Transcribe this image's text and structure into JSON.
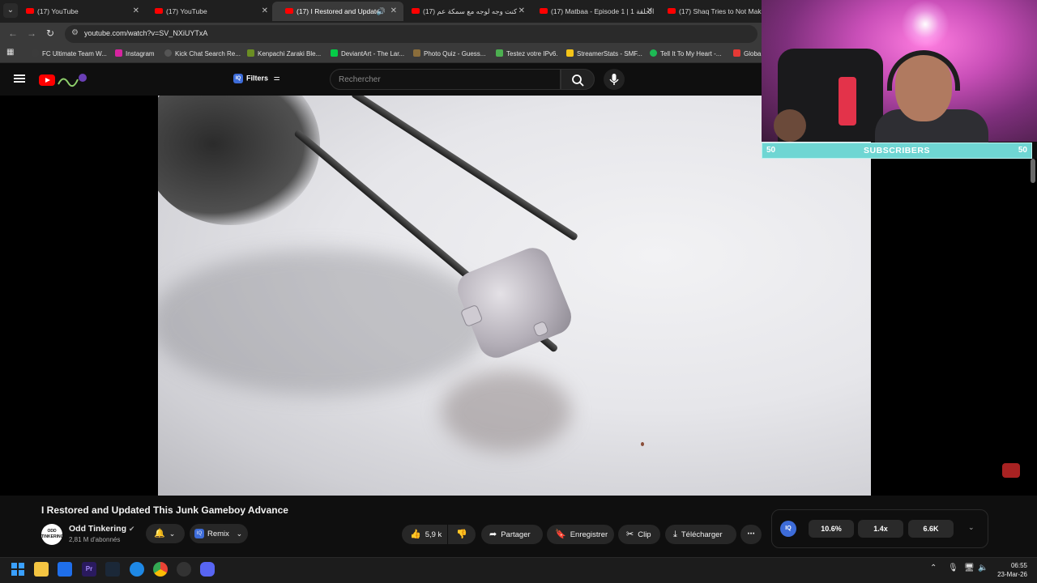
{
  "tabs": [
    {
      "label": "(17) YouTube",
      "active": false
    },
    {
      "label": "(17) YouTube",
      "active": false
    },
    {
      "label": "(17) I Restored and Update",
      "active": true
    },
    {
      "label": "(17) كنت وجه لوجه مع سمكة عم",
      "active": false
    },
    {
      "label": "(17) Matbaa - Episode 1 | 1 الحلقة",
      "active": false
    },
    {
      "label": "(17) Shaq Tries to Not Make",
      "active": false
    }
  ],
  "address": {
    "url": "youtube.com/watch?v=SV_NXiUYTxA"
  },
  "bookmarks": [
    {
      "label": "FC Ultimate Team W...",
      "color": "#3b3b3b"
    },
    {
      "label": "Instagram",
      "color": "#d6249f"
    },
    {
      "label": "Kick Chat Search Re...",
      "color": "#555555"
    },
    {
      "label": "Kenpachi Zaraki Ble...",
      "color": "#6b8e23"
    },
    {
      "label": "DeviantArt - The Lar...",
      "color": "#05cc47"
    },
    {
      "label": "Photo Quiz - Guess...",
      "color": "#8a6d3b"
    },
    {
      "label": "Testez votre IPv6.",
      "color": "#4caf50"
    },
    {
      "label": "StreamerStats - SMF...",
      "color": "#f5c518"
    },
    {
      "label": "Tell It To My Heart -...",
      "color": "#1db954"
    },
    {
      "label": "Globa",
      "color": "#e53935"
    }
  ],
  "header": {
    "filters_label": "Filters",
    "search_placeholder": "Rechercher"
  },
  "overlay": {
    "subscribers_left": "50",
    "subscribers_label": "SUBSCRIBERS",
    "subscribers_right": "50"
  },
  "video": {
    "title": "I Restored and Updated This Junk Gameboy Advance",
    "channel_name": "Odd Tinkering",
    "channel_avatar_text": "ODD TINKERING",
    "subscribers": "2,81 M d'abonnés",
    "remix_label": "Remix",
    "likes": "5,9 k",
    "share_label": "Partager",
    "save_label": "Enregistrer",
    "clip_label": "Clip",
    "download_label": "Télécharger"
  },
  "iq_panel": {
    "logo": "IQ",
    "stats": [
      "10.6%",
      "1.4x",
      "6.6K"
    ]
  },
  "taskbar": {
    "time": "06:55",
    "date": "23-Mar-26"
  },
  "colors": {
    "youtube_red": "#ff0000",
    "subscriber_bar": "#6fd6d3",
    "iq_blue": "#3d6cd9"
  }
}
